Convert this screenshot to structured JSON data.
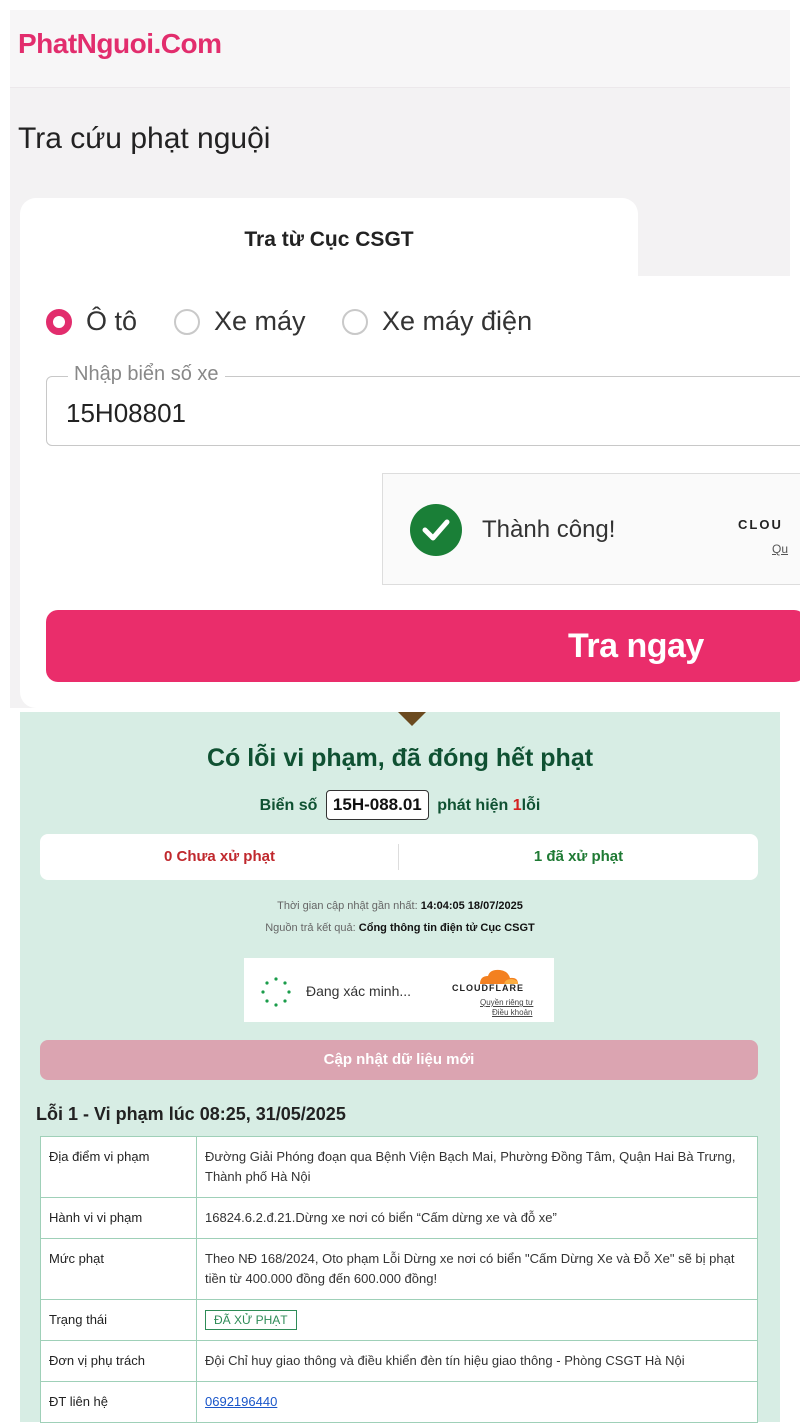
{
  "header": {
    "logo": "PhatNguoi.Com"
  },
  "page_title": "Tra cứu phạt nguội",
  "tab": {
    "label": "Tra từ Cục CSGT"
  },
  "vehicle_types": [
    "Ô tô",
    "Xe máy",
    "Xe máy điện"
  ],
  "selected_vehicle": "Ô tô",
  "plate_input": {
    "label": "Nhập biển số xe",
    "value": "15H08801"
  },
  "captcha_top": {
    "status": "Thành công!",
    "brand": "CLOU",
    "link": "Qu"
  },
  "submit_button": "Tra ngay",
  "result": {
    "title": "Có lỗi vi phạm, đã đóng hết phạt",
    "plate_prefix": "Biển số",
    "plate": "15H-088.01",
    "found_prefix": "phát hiện",
    "found_count": "1",
    "found_suffix": "lỗi",
    "unpaid": "0 Chưa xử phạt",
    "paid": "1 đã xử phạt",
    "updated_label": "Thời gian cập nhật gần nhất:",
    "updated_value": "14:04:05 18/07/2025",
    "source_label": "Nguồn trả kết quả:",
    "source_value": "Cổng thông tin điện tử Cục CSGT"
  },
  "captcha_bottom": {
    "status": "Đang xác minh...",
    "brand": "CLOUDFLARE",
    "privacy": "Quyền riêng tư",
    "terms": "Điều khoản"
  },
  "refresh_button": "Cập nhật dữ liệu mới",
  "violation": {
    "heading": "Lỗi 1 - Vi phạm lúc 08:25, 31/05/2025",
    "location_label": "Địa điểm vi phạm",
    "location": "Đường Giải Phóng đoạn qua Bệnh Viện Bạch Mai, Phường Đồng Tâm, Quận Hai Bà Trưng, Thành phố Hà Nội",
    "behavior_label": "Hành vi vi phạm",
    "behavior": "16824.6.2.đ.21.Dừng xe nơi có biển “Cấm dừng xe và đỗ xe”",
    "fine_label": "Mức phạt",
    "fine": "Theo NĐ 168/2024, Oto phạm Lỗi Dừng xe nơi có biển \"Cấm Dừng Xe và Đỗ Xe\" sẽ bị phạt tiền từ 400.000 đồng đến 600.000 đồng!",
    "status_label": "Trạng thái",
    "status": "ĐÃ XỬ PHẠT",
    "unit_label": "Đơn vị phụ trách",
    "unit": "Đội Chỉ huy giao thông và điều khiển đèn tín hiệu giao thông - Phòng CSGT Hà Nội",
    "phone_label": "ĐT liên hệ",
    "phone": "0692196440"
  },
  "colors": {
    "brand": "#e22d6d",
    "success": "#1a7f37",
    "result_bg": "#d7ede4"
  }
}
